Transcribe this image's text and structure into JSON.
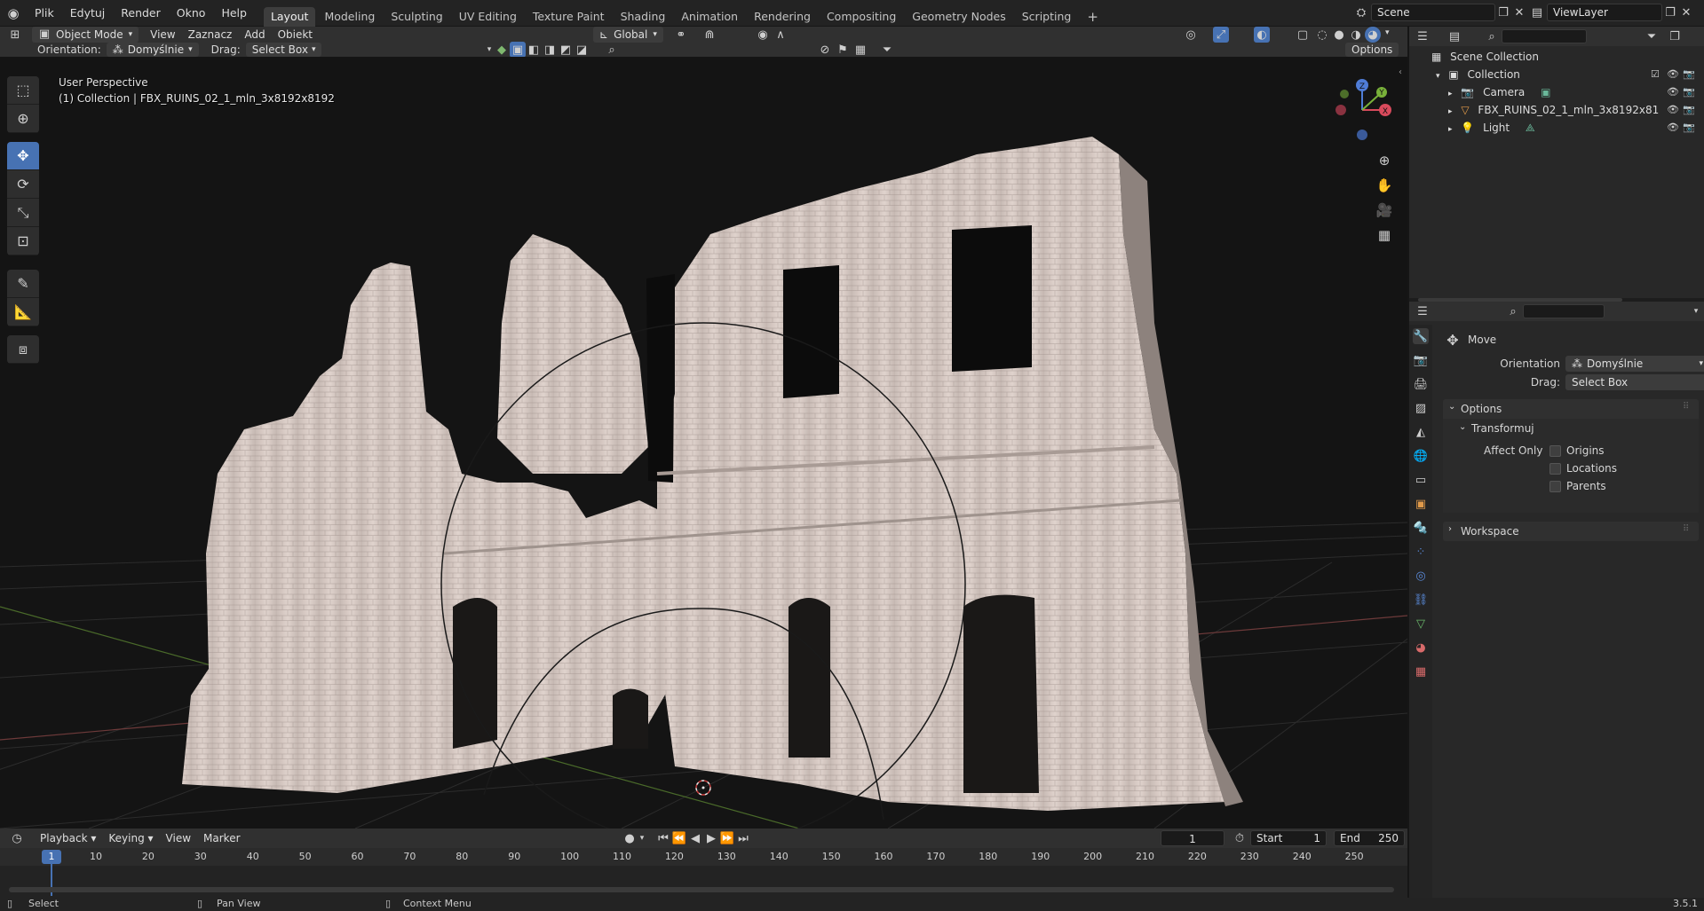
{
  "app": {
    "logo_icon": "blender-logo-icon",
    "menus": [
      "Plik",
      "Edytuj",
      "Render",
      "Okno",
      "Help"
    ],
    "workspaces": [
      "Layout",
      "Modeling",
      "Sculpting",
      "UV Editing",
      "Texture Paint",
      "Shading",
      "Animation",
      "Rendering",
      "Compositing",
      "Geometry Nodes",
      "Scripting"
    ],
    "active_workspace": "Layout",
    "add_workspace": "+",
    "scene": "Scene",
    "view_layer": "ViewLayer",
    "version": "3.5.1"
  },
  "viewport_header": {
    "mode": "Object Mode",
    "menus": [
      "View",
      "Zaznacz",
      "Add",
      "Obiekt"
    ],
    "transform_orientation": "Global",
    "options_label": "Options"
  },
  "tool_header": {
    "orientation_label": "Orientation:",
    "orientation_value": "Domyślnie",
    "drag_label": "Drag:",
    "drag_value": "Select Box"
  },
  "viewport": {
    "perspective": "User Perspective",
    "collection_info": "(1) Collection | FBX_RUINS_02_1_mln_3x8192x8192",
    "gizmo": {
      "z": "Z",
      "y": "Y",
      "x": "X"
    },
    "background_color": "#141414",
    "mesh_color": "#d9ccc6"
  },
  "outliner": {
    "root": "Scene Collection",
    "collection": "Collection",
    "items": [
      {
        "name": "Camera",
        "icon": "camera-icon"
      },
      {
        "name": "FBX_RUINS_02_1_mln_3x8192x81",
        "icon": "mesh-icon"
      },
      {
        "name": "Light",
        "icon": "light-icon"
      }
    ]
  },
  "properties": {
    "tool_name": "Move",
    "orientation_label": "Orientation",
    "orientation_value": "Domyślnie",
    "drag_label": "Drag:",
    "drag_value": "Select Box",
    "options_section": "Options",
    "transform_subsection": "Transformuj",
    "affect_only_label": "Affect Only",
    "checkboxes": [
      "Origins",
      "Locations",
      "Parents"
    ],
    "workspace_section": "Workspace"
  },
  "timeline": {
    "menus": [
      "Playback",
      "Keying",
      "View",
      "Marker"
    ],
    "current_frame": "1",
    "start_label": "Start",
    "start_value": "1",
    "end_label": "End",
    "end_value": "250",
    "ruler": [
      "10",
      "20",
      "30",
      "40",
      "50",
      "60",
      "70",
      "80",
      "90",
      "100",
      "110",
      "120",
      "130",
      "140",
      "150",
      "160",
      "170",
      "180",
      "190",
      "200",
      "210",
      "220",
      "230",
      "240",
      "250"
    ],
    "playhead": "1"
  },
  "statusbar": {
    "select": "Select",
    "pan": "Pan View",
    "context": "Context Menu"
  },
  "colors": {
    "accent": "#4772b3",
    "panel": "#282828",
    "header": "#303030"
  }
}
